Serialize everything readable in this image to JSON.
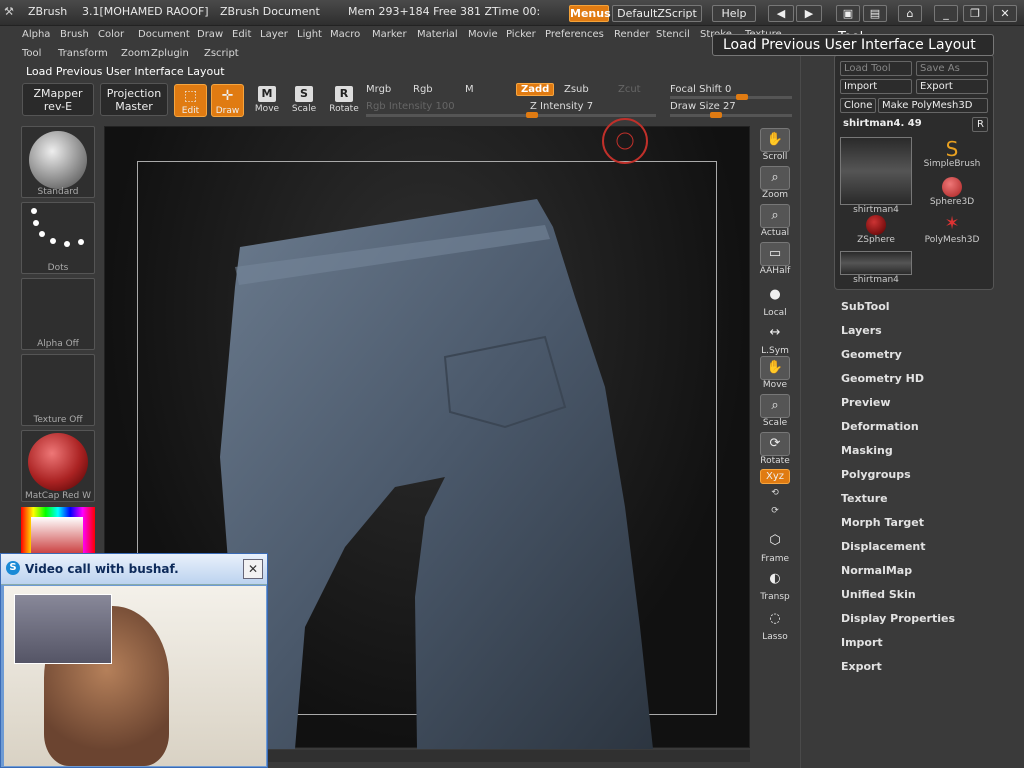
{
  "titlebar": {
    "app": "ZBrush",
    "version": "3.1[MOHAMED RAOOF]",
    "document": "ZBrush Document",
    "mem": "Mem 293+184 Free 381 ZTime 00:",
    "menus_btn": "Menus",
    "script_btn": "DefaultZScript",
    "help_btn": "Help"
  },
  "menubar": {
    "row1": [
      "Alpha",
      "Brush",
      "Color",
      "Document",
      "Draw",
      "Edit",
      "Layer",
      "Light",
      "Macro",
      "Marker",
      "Material",
      "Movie",
      "Picker",
      "Preferences",
      "Render",
      "Stencil",
      "Stroke",
      "Texture"
    ],
    "row2": [
      "Tool",
      "Transform",
      "Zoom",
      "Zplugin",
      "Zscript"
    ]
  },
  "tooltip": "Load Previous User Interface Layout",
  "tool_title": "Tool",
  "last_command": "Load Previous User Interface Layout",
  "toolbar": {
    "zmapper": "ZMapper rev-E",
    "projection": "Projection Master",
    "edit": "Edit",
    "draw": "Draw",
    "move": "Move",
    "scale": "Scale",
    "rotate": "Rotate",
    "mrgb": "Mrgb",
    "rgb": "Rgb",
    "m": "M",
    "zadd": "Zadd",
    "zsub": "Zsub",
    "zcut": "Zcut",
    "rgb_intensity": "Rgb Intensity 100",
    "z_intensity": "Z Intensity 7",
    "focal_shift": "Focal Shift 0",
    "draw_size": "Draw Size 27"
  },
  "left_shelf": {
    "brush": "Standard",
    "stroke": "Dots",
    "alpha": "Alpha Off",
    "texture": "Texture Off",
    "material": "MatCap Red W"
  },
  "right_shelf": [
    "Scroll",
    "Zoom",
    "Actual",
    "AAHalf",
    "Local",
    "L.Sym",
    "Move",
    "Scale",
    "Rotate",
    "Xyz",
    "Frame",
    "Transp",
    "Lasso"
  ],
  "tool_palette": {
    "load_tool": "Load Tool",
    "save_as": "Save As",
    "import": "Import",
    "export": "Export",
    "clone": "Clone",
    "make_polymesh": "Make PolyMesh3D",
    "current": "shirtman4. 49",
    "r": "R",
    "thumbs": [
      "shirtman4",
      "SimpleBrush",
      "Sphere3D",
      "ZSphere",
      "PolyMesh3D",
      "shirtman4"
    ]
  },
  "right_menu": [
    "SubTool",
    "Layers",
    "Geometry",
    "Geometry HD",
    "Preview",
    "Deformation",
    "Masking",
    "Polygroups",
    "Texture",
    "Morph Target",
    "Displacement",
    "NormalMap",
    "Unified Skin",
    "Display Properties",
    "Import",
    "Export"
  ],
  "video": {
    "title": "Video call with bushaf."
  },
  "colors": {
    "accent": "#e07b12",
    "bg": "#3a3a3a"
  }
}
